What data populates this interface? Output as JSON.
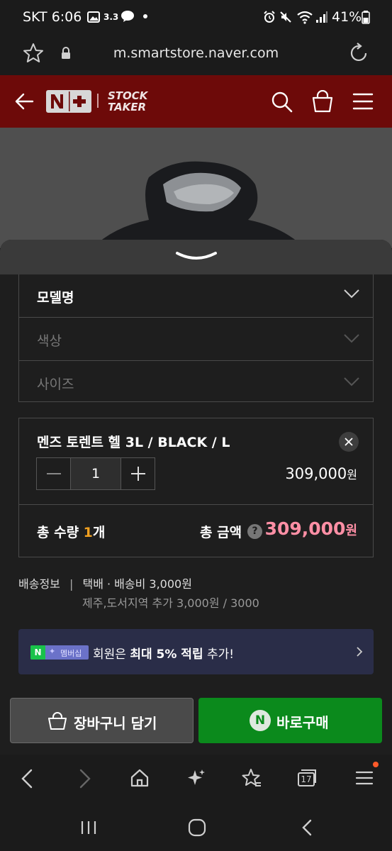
{
  "status_bar": {
    "carrier_time": "SKT 6:06",
    "weather": "3.3",
    "battery": "41%"
  },
  "browser": {
    "url": "m.smartstore.naver.com"
  },
  "header": {
    "brand_line1": "STOCK",
    "brand_line2": "TAKER"
  },
  "options": {
    "model_label": "모델명",
    "color_label": "색상",
    "size_label": "사이즈"
  },
  "selected_item": {
    "name": "멘즈 토렌트 헬 3L / BLACK / L",
    "quantity": "1",
    "price": "309,000",
    "price_unit": "원"
  },
  "totals": {
    "qty_prefix": "총 수량 ",
    "qty_value": "1",
    "qty_suffix": "개",
    "amount_label": "총 금액",
    "amount_value": "309,000",
    "amount_unit": "원"
  },
  "shipping": {
    "label": "배송정보",
    "separator": "|",
    "method": "택배 · 배송비 3,000원",
    "extra": "제주,도서지역 추가 3,000원 / 3000"
  },
  "membership": {
    "badge_text": "멤버십",
    "text_prefix": "회원은 ",
    "text_bold": "최대 5% 적립",
    "text_suffix": " 추가!"
  },
  "cta": {
    "cart_label": "장바구니 담기",
    "buy_label": "바로구매"
  },
  "browser_nav": {
    "tabs_count": "17"
  },
  "colors": {
    "header_bg": "#6d0a09",
    "accent_orange": "#f0a020",
    "price_pink": "#ff8fa5",
    "buy_green": "#0b8a1c"
  }
}
